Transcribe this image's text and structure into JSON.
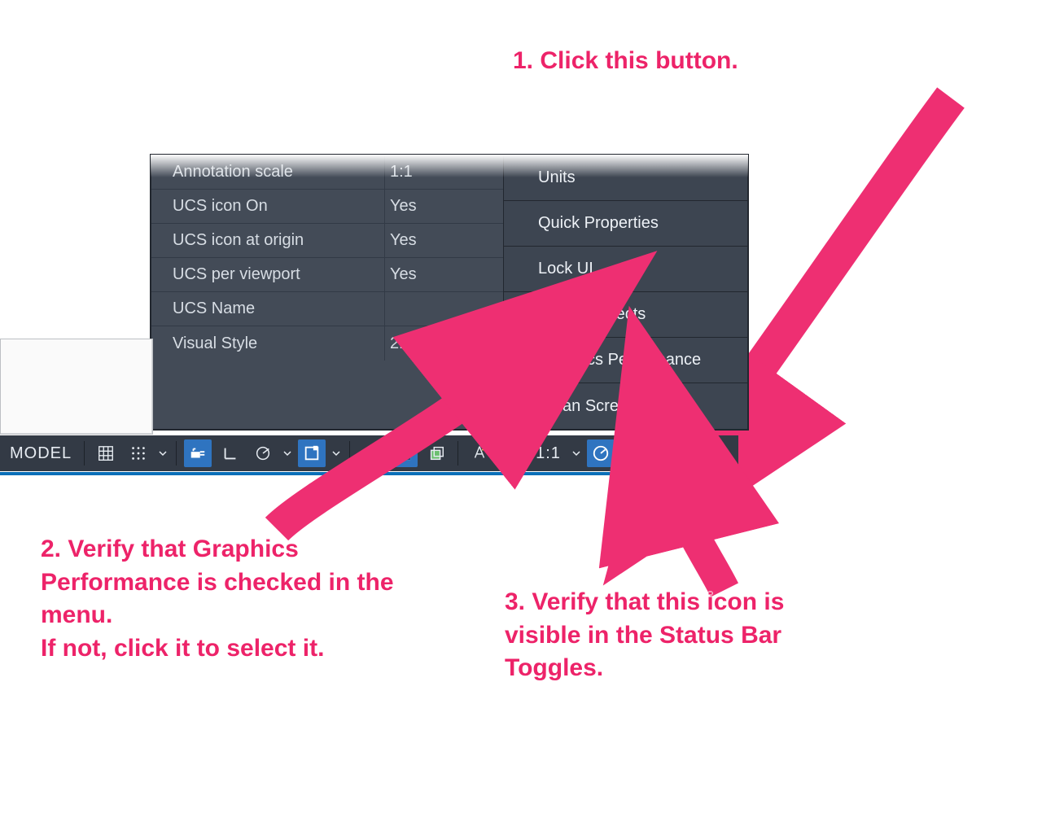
{
  "annotations": {
    "step1": "1. Click this button.",
    "step2": "2. Verify that Graphics Performance is checked in the menu.\nIf not, click it to select it.",
    "step3": "3. Verify that this icon is visible in the Status Bar Toggles."
  },
  "properties": [
    {
      "label": "Annotation scale",
      "value": "1:1"
    },
    {
      "label": "UCS icon On",
      "value": "Yes"
    },
    {
      "label": "UCS icon at origin",
      "value": "Yes"
    },
    {
      "label": "UCS per viewport",
      "value": "Yes"
    },
    {
      "label": "UCS Name",
      "value": ""
    },
    {
      "label": "Visual Style",
      "value": "2D Wiref"
    }
  ],
  "menu": {
    "items": [
      {
        "label": "Units",
        "checked": false
      },
      {
        "label": "Quick Properties",
        "checked": false
      },
      {
        "label": "Lock UI",
        "checked": false
      },
      {
        "label": "Isolate Objects",
        "checked": false
      },
      {
        "label": "Graphics Performance",
        "checked": true
      },
      {
        "label": "Clean Screen",
        "checked": false
      }
    ]
  },
  "statusbar": {
    "model": "MODEL",
    "scale": "1:1"
  }
}
